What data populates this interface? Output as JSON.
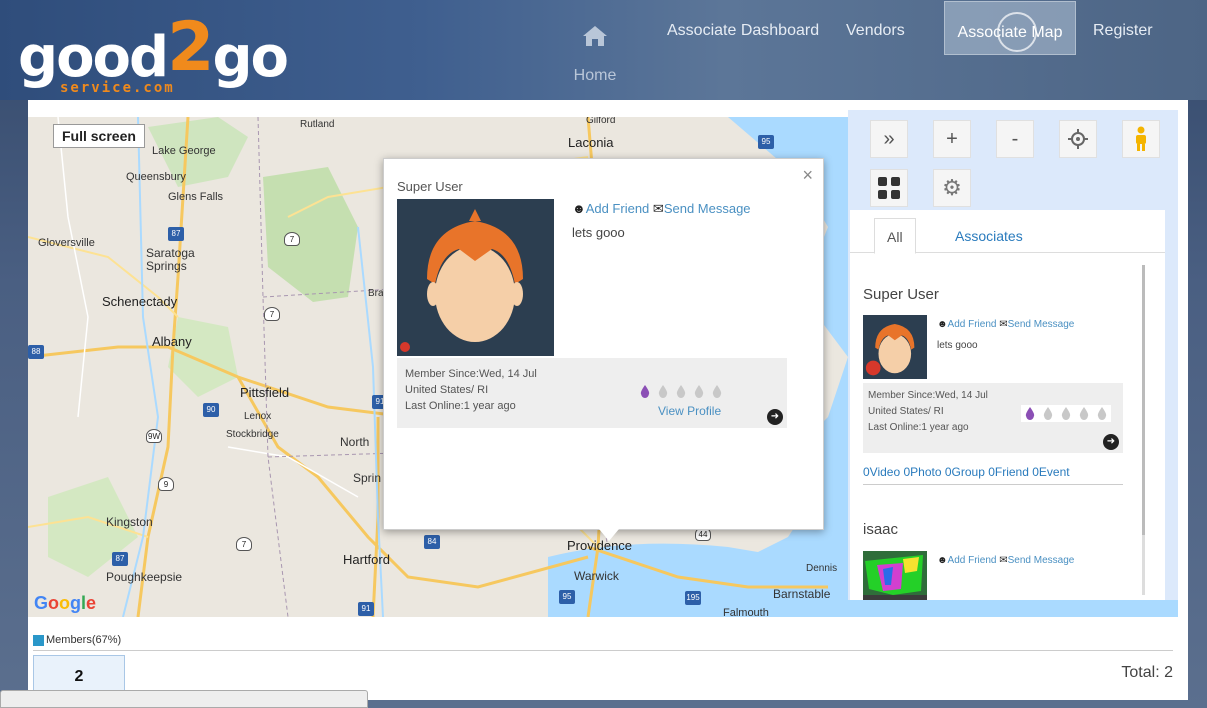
{
  "logo": {
    "text_main": "good",
    "text_two": "2",
    "text_go": "go",
    "sub": "service.com"
  },
  "nav": {
    "home_label": "Home",
    "items": [
      "Associate Dashboard",
      "Vendors",
      "Associate Map",
      "Register"
    ],
    "active_index": 2
  },
  "map": {
    "fullscreen_label": "Full screen",
    "provider": "Google",
    "labels": [
      "Laconia",
      "Gilford",
      "Rutland",
      "Lake George",
      "Queensbury",
      "Glens Falls",
      "Gloversville",
      "Saratoga Springs",
      "Schenectady",
      "Albany",
      "Pittsfield",
      "Lenox",
      "Stockbridge",
      "North",
      "Sprin",
      "Kingston",
      "Poughkeepsie",
      "Hartford",
      "Providence",
      "Warwick",
      "Barnstable",
      "Dennis",
      "Falmouth",
      "Brat"
    ]
  },
  "popup": {
    "name": "Super User",
    "add_friend": "Add Friend",
    "send_message": "Send Message",
    "status": "lets gooo",
    "member_since": "Member Since:Wed, 14 Jul",
    "location": "United States/ RI",
    "last_online": "Last Online:1 year ago",
    "view_profile": "View Profile",
    "close": "×",
    "rating": 1,
    "rating_max": 5
  },
  "tools": [
    "»",
    "+",
    "-",
    "locate",
    "person",
    "grid",
    "gear"
  ],
  "tabs": [
    "All",
    "Associates"
  ],
  "members": [
    {
      "name": "Super User",
      "add_friend": "Add Friend",
      "send_message": "Send Message",
      "status": "lets gooo",
      "member_since": "Member Since:Wed, 14 Jul",
      "location": "United States/ RI",
      "last_online": "Last Online:1 year ago",
      "counts": "0Video 0Photo 0Group 0Friend 0Event",
      "rating": 1
    },
    {
      "name": "isaac",
      "add_friend": "Add Friend",
      "send_message": "Send Message"
    }
  ],
  "legend": {
    "label": "Members(67%)",
    "color": "#2a97c9"
  },
  "count_box": "2",
  "total": "Total: 2",
  "colors": {
    "brand_orange": "#f08a1c",
    "link": "#4a90c2",
    "rating": "#8b4fb5"
  }
}
